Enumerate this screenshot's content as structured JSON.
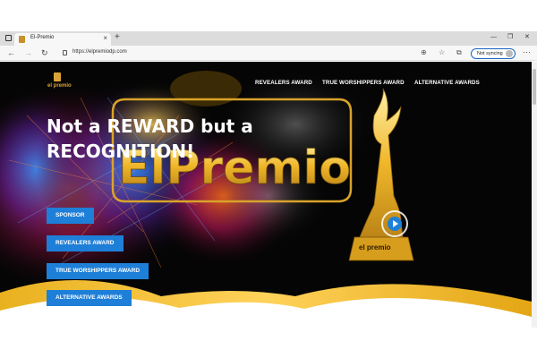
{
  "browser": {
    "tab": {
      "title": "El-Premio",
      "close": "×"
    },
    "new_tab": "+",
    "window": {
      "minimize": "—",
      "restore": "❐",
      "close": "✕"
    },
    "nav": {
      "back": "←",
      "forward": "→",
      "refresh": "↻"
    },
    "url": "https://elpremiodp.com",
    "sync_label": "Not syncing",
    "menu": "···",
    "toolbar_icons": {
      "add_page": "⊕",
      "favorites": "☆",
      "collections": "⧉",
      "extensions": "⊞"
    }
  },
  "site": {
    "logo_text": "el premio",
    "nav": [
      {
        "label": "REVEALERS AWARD"
      },
      {
        "label": "TRUE WORSHIPPERS AWARD"
      },
      {
        "label": "ALTERNATIVE AWARDS"
      }
    ],
    "headline": "Not a REWARD but a RECOGNITION!",
    "background_text": "ElPremio",
    "trophy_label": "el premio",
    "buttons": [
      {
        "label": "SPONSOR"
      },
      {
        "label": "REVEALERS AWARD"
      },
      {
        "label": "TRUE WORSHIPPERS AWARD"
      },
      {
        "label": "ALTERNATIVE AWARDS"
      }
    ],
    "colors": {
      "accent": "#1e7fd8",
      "gold": "#e6b422",
      "background": "#050505"
    }
  }
}
